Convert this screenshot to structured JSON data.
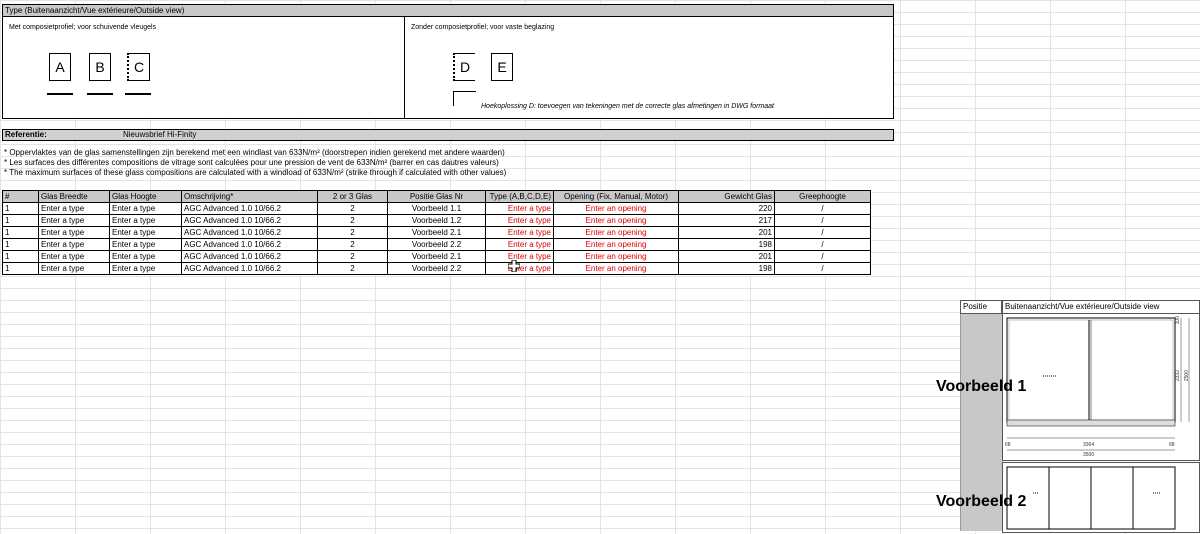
{
  "type_panel": {
    "header": "Type (Buitenaanzicht/Vue extérieure/Outside view)",
    "left_caption": "Met composietprofiel; voor schuivende vleugels",
    "right_caption": "Zonder composietprofiel; voor vaste beglazing",
    "letters_left": [
      "A",
      "B",
      "C"
    ],
    "letters_right": [
      "D",
      "E"
    ],
    "hoek_note": "Hoekoplossing D: toevoegen van tekeningen met de correcte glas afmetingen in DWG formaat"
  },
  "reference": {
    "label": "Referentie:",
    "value": "Nieuwsbrief Hi-Finity"
  },
  "notes": [
    "* Oppervlaktes van de glas samenstellingen zijn berekend met een windlast van 633N/m² (doorstrepen indien gerekend met andere waarden)",
    "* Les surfaces des différentes compositions de vitrage sont calculées pour une pression de vent de 633N/m² (barrer en cas dautres valeurs)",
    "* The maximum surfaces of these glass compositions are calculated with a windload of 633N/m² (strike through if calculated with other values)"
  ],
  "table": {
    "headers": [
      "#",
      "Glas Breedte",
      "Glas Hoogte",
      "Omschrijving*",
      "2 or 3 Glas",
      "Positie Glas Nr",
      "Type (A,B,C,D,E)",
      "Opening (Fix, Manual, Motor)",
      "Gewicht Glas",
      "Greephoogte"
    ],
    "rows": [
      [
        "1",
        "Enter a type",
        "Enter a type",
        "AGC Advanced 1.0 10/66.2",
        "2",
        "Voorbeeld 1.1",
        "Enter a type",
        "Enter an opening",
        "220",
        "/"
      ],
      [
        "1",
        "Enter a type",
        "Enter a type",
        "AGC Advanced 1.0 10/66.2",
        "2",
        "Voorbeeld 1.2",
        "Enter a type",
        "Enter an opening",
        "217",
        "/"
      ],
      [
        "1",
        "Enter a type",
        "Enter a type",
        "AGC Advanced 1.0 10/66.2",
        "2",
        "Voorbeeld 2.1",
        "Enter a type",
        "Enter an opening",
        "201",
        "/"
      ],
      [
        "1",
        "Enter a type",
        "Enter a type",
        "AGC Advanced 1.0 10/66.2",
        "2",
        "Voorbeeld 2.2",
        "Enter a type",
        "Enter an opening",
        "198",
        "/"
      ],
      [
        "1",
        "Enter a type",
        "Enter a type",
        "AGC Advanced 1.0 10/66.2",
        "2",
        "Voorbeeld 2.1",
        "Enter a type",
        "Enter an opening",
        "201",
        "/"
      ],
      [
        "1",
        "Enter a type",
        "Enter a type",
        "AGC Advanced 1.0 10/66.2",
        "2",
        "Voorbeeld 2.2",
        "Enter a type",
        "Enter an opening",
        "198",
        "/"
      ]
    ]
  },
  "side": {
    "positie_header": "Positie",
    "view_header": "Buitenaanzicht/Vue extérieure/Outside view",
    "examples": [
      "Voorbeeld 1",
      "Voorbeeld 2"
    ],
    "dims": {
      "width_inner": "3364",
      "width_outer": "3500",
      "left_offset": "68",
      "right_offset": "68",
      "height_a": "2332",
      "height_b": "2500",
      "top_offset": "100"
    }
  },
  "colors": {
    "header_grey": "#c8c8c8",
    "placeholder_red": "#e00000",
    "grid_line": "#e4e4e4"
  }
}
